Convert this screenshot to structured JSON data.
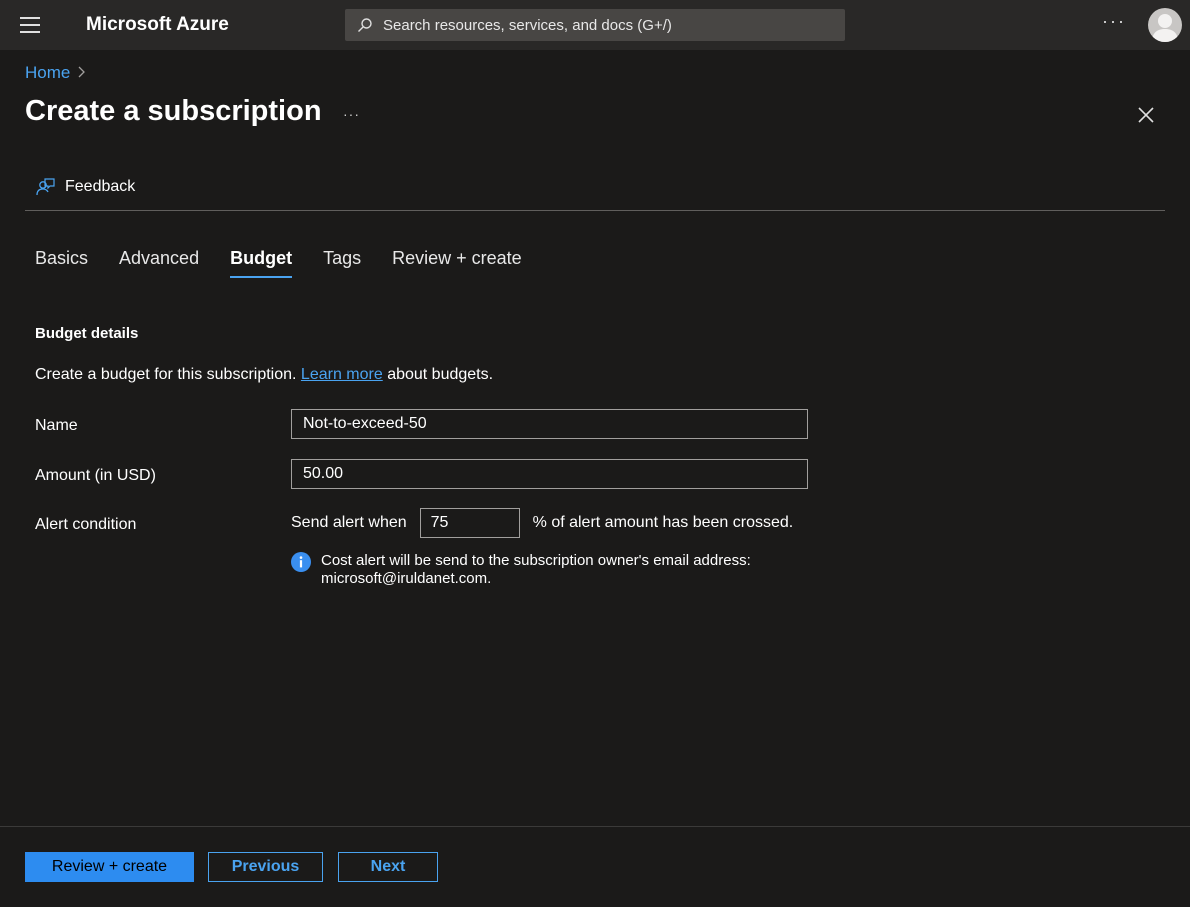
{
  "topbar": {
    "brand": "Microsoft Azure",
    "search_placeholder": "Search resources, services, and docs (G+/)",
    "more": "···"
  },
  "breadcrumb": {
    "home": "Home"
  },
  "page": {
    "title": "Create a subscription",
    "title_more": "···"
  },
  "toolbar": {
    "feedback": "Feedback"
  },
  "tabs": [
    {
      "label": "Basics",
      "active": false
    },
    {
      "label": "Advanced",
      "active": false
    },
    {
      "label": "Budget",
      "active": true
    },
    {
      "label": "Tags",
      "active": false
    },
    {
      "label": "Review + create",
      "active": false
    }
  ],
  "budget": {
    "section_title": "Budget details",
    "desc_before": "Create a budget for this subscription. ",
    "learn_more": "Learn more",
    "desc_after": " about budgets.",
    "name_label": "Name",
    "name_value": "Not-to-exceed-50",
    "amount_label": "Amount (in USD)",
    "amount_value": "50.00",
    "alert_label": "Alert condition",
    "alert_prefix": "Send alert when",
    "alert_value": "75",
    "alert_suffix": "% of alert amount has been crossed.",
    "info_line1": "Cost alert will be send to the subscription owner's email address:",
    "info_line2": "microsoft@iruldanet.com."
  },
  "footer": {
    "review_create": "Review + create",
    "previous": "Previous",
    "next": "Next"
  },
  "colors": {
    "accent": "#4aa3f0",
    "primary_button": "#2d8cf0",
    "background": "#1b1a19"
  }
}
